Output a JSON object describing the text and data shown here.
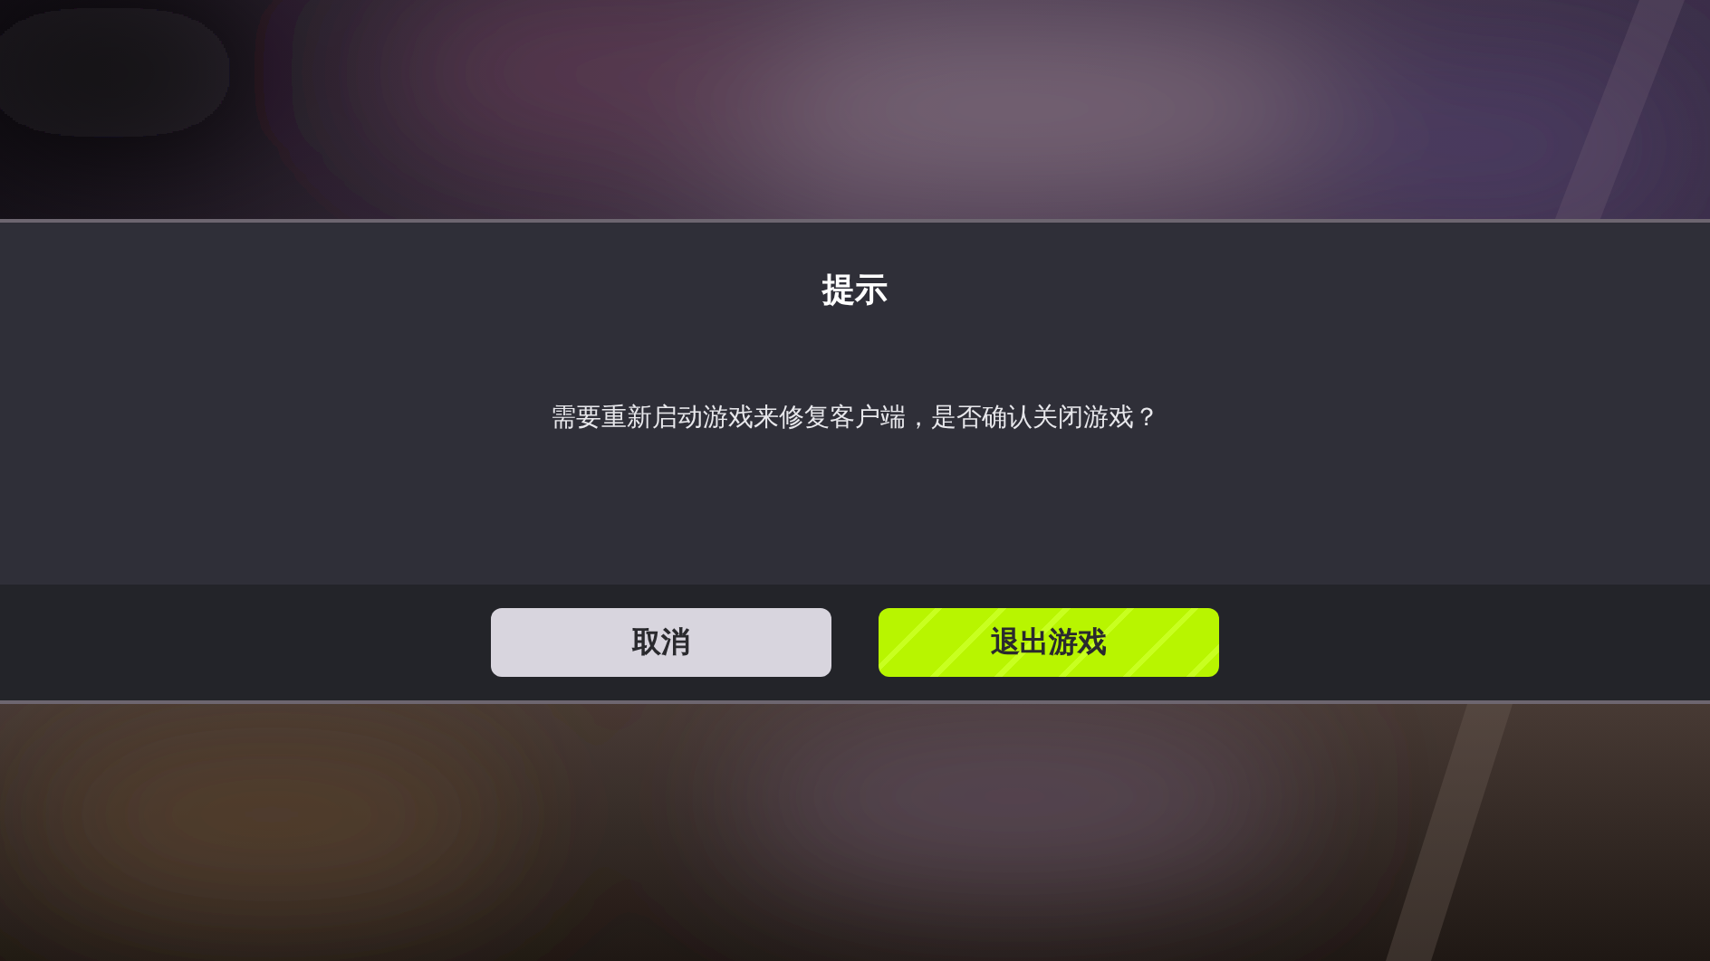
{
  "dialog": {
    "title": "提示",
    "message": "需要重新启动游戏来修复客户端，是否确认关闭游戏？",
    "buttons": [
      {
        "label": "取消",
        "kind": "secondary"
      },
      {
        "label": "退出游戏",
        "kind": "primary"
      }
    ]
  }
}
